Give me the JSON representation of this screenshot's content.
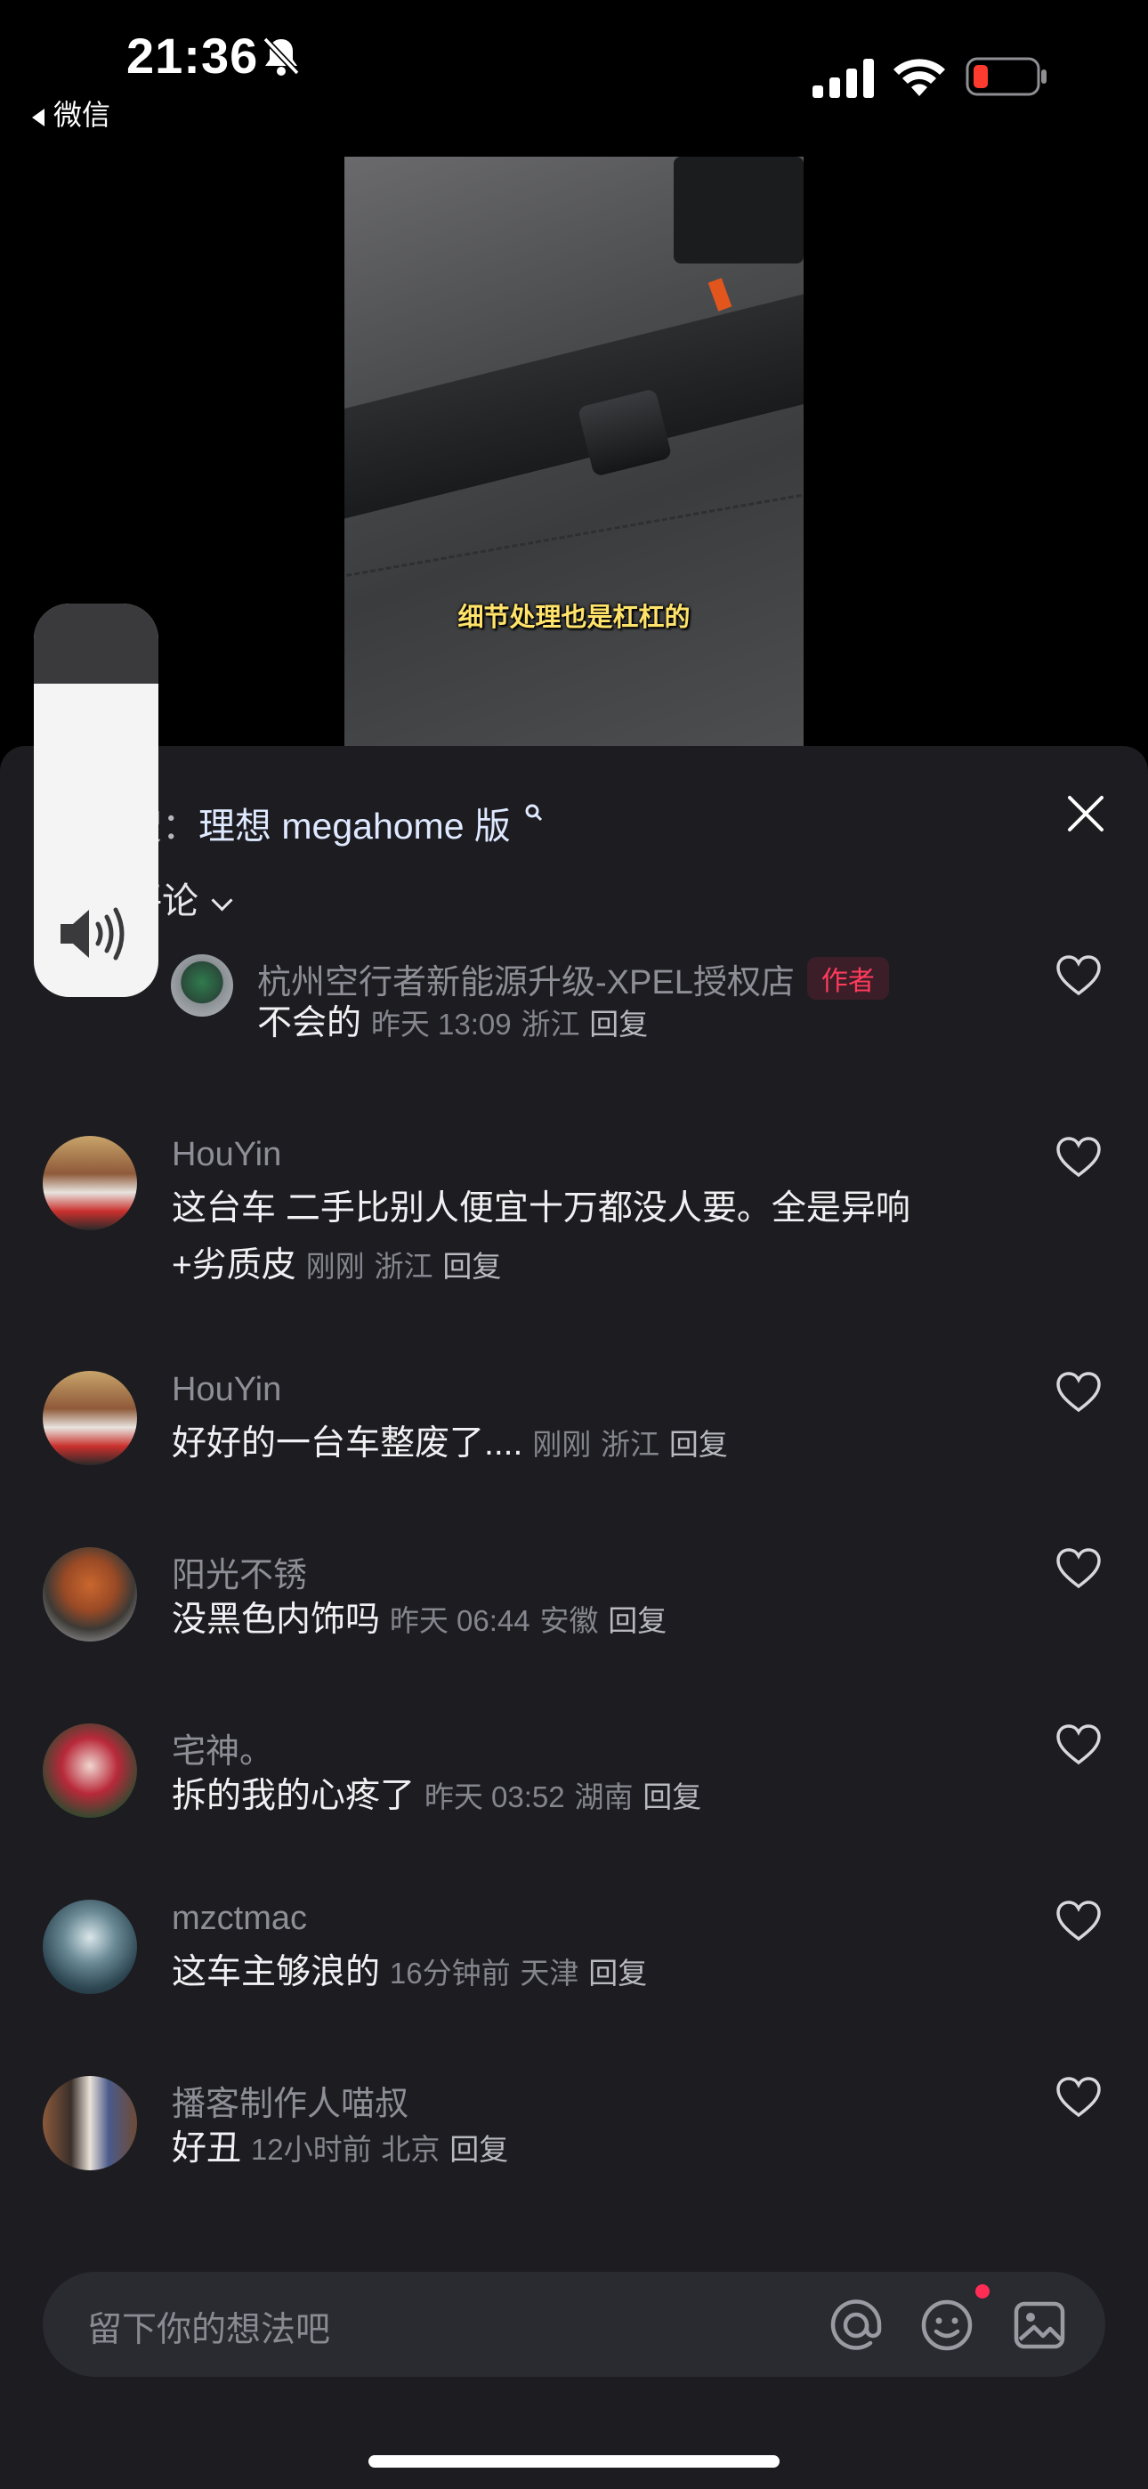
{
  "status_bar": {
    "time": "21:36",
    "back_app": "微信",
    "battery_color": "#ff3b30"
  },
  "video": {
    "subtitle": "细节处理也是杠杠的"
  },
  "sheet": {
    "search_prefix": "在搜：",
    "search_keyword": "理想 megahome 版",
    "count_label": "条评论"
  },
  "comments": [
    {
      "name": "杭州空行者新能源升级-XPEL授权店",
      "badge": "作者",
      "text": "不会的",
      "time": "昨天 13:09",
      "location": "浙江",
      "reply": "回复"
    },
    {
      "name": "HouYin",
      "text1": "这台车 二手比别人便宜十万都没人要。全是异响",
      "text2": "+劣质皮",
      "time": "刚刚",
      "location": "浙江",
      "reply": "回复"
    },
    {
      "name": "HouYin",
      "text": "好好的一台车整废了....",
      "time": "刚刚",
      "location": "浙江",
      "reply": "回复"
    },
    {
      "name": "阳光不锈",
      "text": "没黑色内饰吗",
      "time": "昨天 06:44",
      "location": "安徽",
      "reply": "回复"
    },
    {
      "name": "宅神。",
      "text": "拆的我的心疼了",
      "time": "昨天 03:52",
      "location": "湖南",
      "reply": "回复"
    },
    {
      "name": "mzctmac",
      "text": "这车主够浪的",
      "time": "16分钟前",
      "location": "天津",
      "reply": "回复"
    },
    {
      "name": "播客制作人喵叔",
      "text": "好丑",
      "time": "12小时前",
      "location": "北京",
      "reply": "回复"
    }
  ],
  "input": {
    "placeholder": "留下你的想法吧"
  },
  "icons": [
    "bell-off-icon",
    "signal-icon",
    "wifi-icon",
    "battery-icon",
    "search-icon",
    "close-icon",
    "chevron-down-icon",
    "heart-icon",
    "speaker-icon",
    "at-icon",
    "emoji-icon",
    "image-icon"
  ]
}
